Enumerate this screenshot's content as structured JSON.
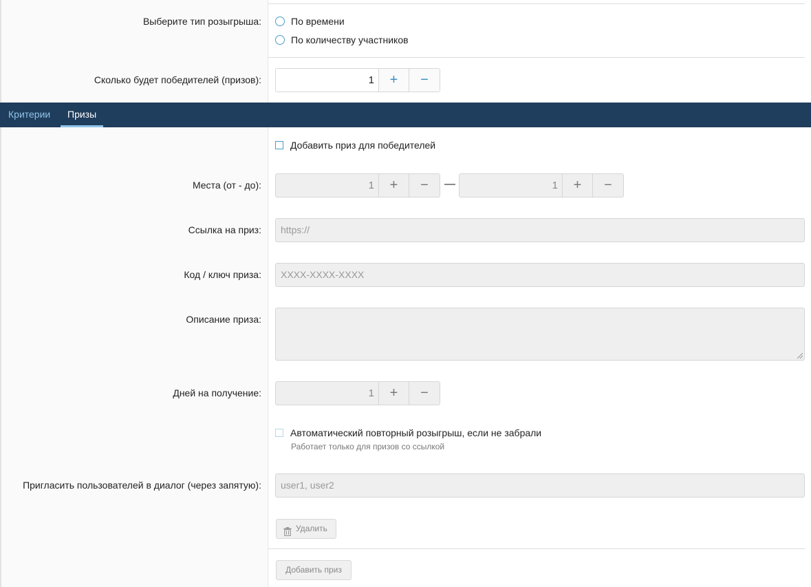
{
  "form": {
    "draw_type": {
      "label": "Выберите тип розыгрыша:",
      "options": [
        "По времени",
        "По количеству участников"
      ]
    },
    "winners": {
      "label": "Сколько будет победителей (призов):",
      "value": "1"
    }
  },
  "tabs": [
    {
      "label": "Критерии",
      "active": false
    },
    {
      "label": "Призы",
      "active": true
    }
  ],
  "prize": {
    "add_prize_checkbox": "Добавить приз для победителей",
    "places": {
      "label": "Места (от - до):",
      "from": "1",
      "to": "1",
      "separator": "—"
    },
    "link": {
      "label": "Ссылка на приз:",
      "placeholder": "https://"
    },
    "code": {
      "label": "Код / ключ приза:",
      "placeholder": "XXXX-XXXX-XXXX"
    },
    "description": {
      "label": "Описание приза:"
    },
    "days": {
      "label": "Дней на получение:",
      "value": "1"
    },
    "auto_redraw": {
      "label": "Автоматический повторный розыгрыш, если не забрали",
      "hint": "Работает только для призов со ссылкой"
    },
    "invite": {
      "label": "Пригласить пользователей в диалог (через запятую):",
      "placeholder": "user1, user2"
    },
    "delete_button": "Удалить"
  },
  "add_prize_button": "Добавить приз",
  "stepper": {
    "plus": "+",
    "minus": "−"
  },
  "colors": {
    "tabbar": "#1f3d5c",
    "tab_inactive": "#8fc4ea",
    "accent": "#4a9cc9"
  }
}
